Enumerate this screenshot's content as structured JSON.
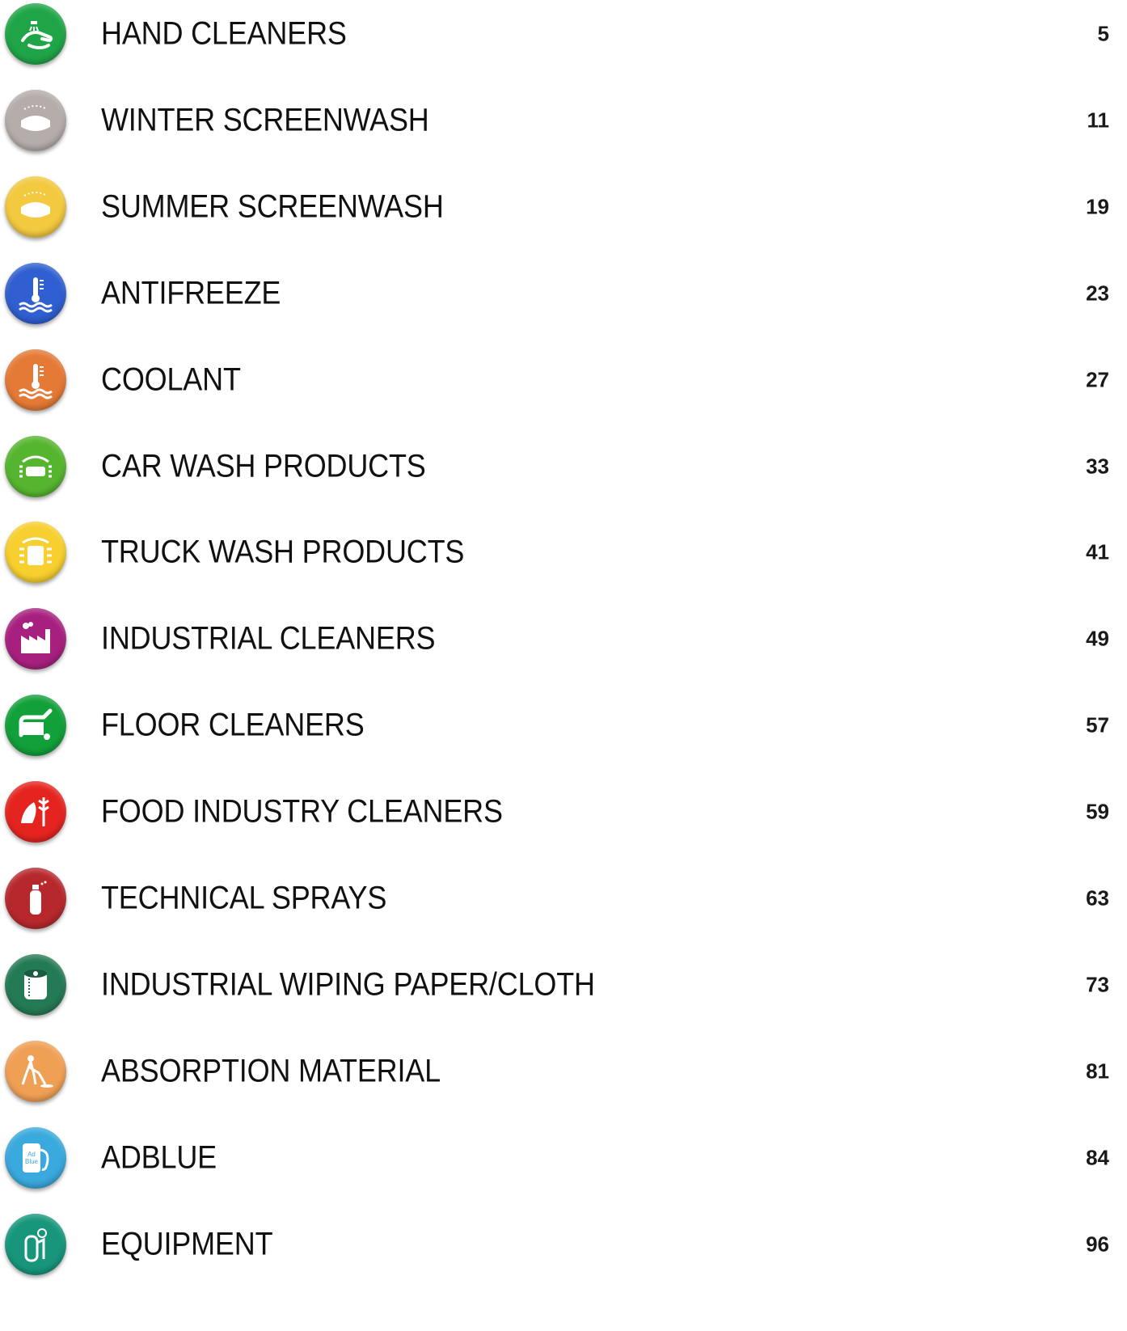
{
  "entries": [
    {
      "title": "HAND CLEANERS",
      "page": "5",
      "color": "#1fa547",
      "icon": "hand-wash-icon"
    },
    {
      "title": "WINTER SCREENWASH",
      "page": "11",
      "color": "#b5adaa",
      "icon": "windscreen-icon"
    },
    {
      "title": "SUMMER SCREENWASH",
      "page": "19",
      "color": "#f3c93f",
      "icon": "windscreen-icon"
    },
    {
      "title": "ANTIFREEZE",
      "page": "23",
      "color": "#2f5fd0",
      "icon": "thermometer-water-icon"
    },
    {
      "title": "COOLANT",
      "page": "27",
      "color": "#e57a36",
      "icon": "thermometer-water-icon"
    },
    {
      "title": "CAR WASH PRODUCTS",
      "page": "33",
      "color": "#56b52f",
      "icon": "car-wash-icon"
    },
    {
      "title": "TRUCK WASH PRODUCTS",
      "page": "41",
      "color": "#f7cf2e",
      "icon": "truck-wash-icon"
    },
    {
      "title": "INDUSTRIAL CLEANERS",
      "page": "49",
      "color": "#a8207f",
      "icon": "factory-icon"
    },
    {
      "title": "FLOOR CLEANERS",
      "page": "57",
      "color": "#12a03a",
      "icon": "floor-scrubber-icon"
    },
    {
      "title": "FOOD INDUSTRY CLEANERS",
      "page": "59",
      "color": "#e52420",
      "icon": "ham-wheat-icon"
    },
    {
      "title": "TECHNICAL SPRAYS",
      "page": "63",
      "color": "#b7282c",
      "icon": "spray-can-icon"
    },
    {
      "title": "INDUSTRIAL WIPING PAPER/CLOTH",
      "page": "73",
      "color": "#247a55",
      "icon": "paper-roll-icon"
    },
    {
      "title": "ABSORPTION MATERIAL",
      "page": "81",
      "color": "#f0a055",
      "icon": "person-absorbent-icon"
    },
    {
      "title": "ADBLUE",
      "page": "84",
      "color": "#3aa9dd",
      "icon": "adblue-pump-icon"
    },
    {
      "title": "EQUIPMENT",
      "page": "96",
      "color": "#17967b",
      "icon": "sprayer-icon"
    }
  ],
  "adblue_icon_text": "Ad Blue"
}
